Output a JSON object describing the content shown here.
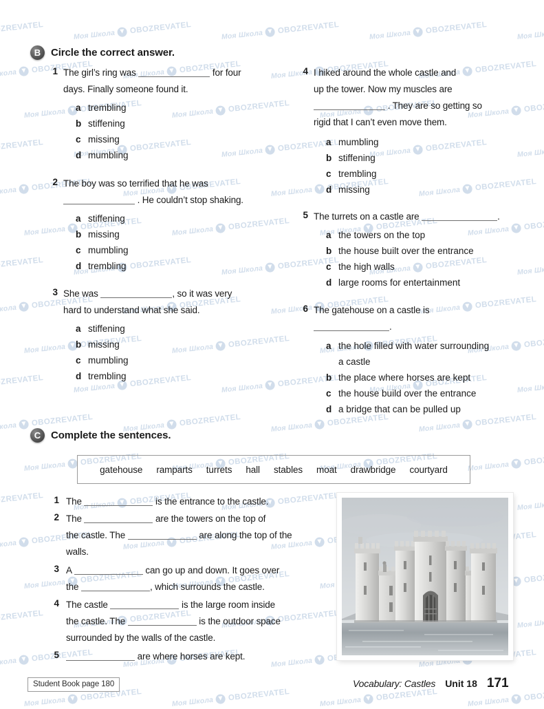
{
  "watermark": {
    "ru": "Моя Школа",
    "en": "OBOZREVATEL"
  },
  "exercise_b": {
    "badge": "B",
    "title": "Circle the correct answer.",
    "questions": [
      {
        "num": "1",
        "lines": [
          "The girl’s ring was ____ for four",
          "days. Finally someone found it."
        ],
        "line1_pre": "The girl’s ring was",
        "line1_post": "for four",
        "line2": "days. Finally someone found it.",
        "options": [
          {
            "letter": "a",
            "text": "trembling"
          },
          {
            "letter": "b",
            "text": "stiffening"
          },
          {
            "letter": "c",
            "text": "missing"
          },
          {
            "letter": "d",
            "text": "mumbling"
          }
        ]
      },
      {
        "num": "2",
        "line1": "The boy was so terrified that he was",
        "line2_post": ". He couldn’t stop shaking.",
        "options": [
          {
            "letter": "a",
            "text": "stiffening"
          },
          {
            "letter": "b",
            "text": "missing"
          },
          {
            "letter": "c",
            "text": "mumbling"
          },
          {
            "letter": "d",
            "text": "trembling"
          }
        ]
      },
      {
        "num": "3",
        "line1_pre": "She was",
        "line1_post": ", so it was very",
        "line2": "hard to understand what she said.",
        "options": [
          {
            "letter": "a",
            "text": "stiffening"
          },
          {
            "letter": "b",
            "text": "missing"
          },
          {
            "letter": "c",
            "text": "mumbling"
          },
          {
            "letter": "d",
            "text": "trembling"
          }
        ]
      },
      {
        "num": "4",
        "line1": "I hiked around the whole castle and",
        "line2": "up the tower. Now my muscles are",
        "line3_post": ". They are so getting so",
        "line4": "rigid that I can’t even move them.",
        "options": [
          {
            "letter": "a",
            "text": "mumbling"
          },
          {
            "letter": "b",
            "text": "stiffening"
          },
          {
            "letter": "c",
            "text": "trembling"
          },
          {
            "letter": "d",
            "text": "missing"
          }
        ]
      },
      {
        "num": "5",
        "line1_pre": "The turrets on a castle are",
        "line1_post": ".",
        "options": [
          {
            "letter": "a",
            "text": "the towers on the top"
          },
          {
            "letter": "b",
            "text": "the house built over the entrance"
          },
          {
            "letter": "c",
            "text": "the high walls"
          },
          {
            "letter": "d",
            "text": "large rooms for entertainment"
          }
        ]
      },
      {
        "num": "6",
        "line1": "The gatehouse on a castle is",
        "line2_post": ".",
        "options": [
          {
            "letter": "a",
            "text": "the hole filled with water surrounding"
          },
          {
            "letter": "a2",
            "text": "a castle"
          },
          {
            "letter": "b",
            "text": "the place where horses are kept"
          },
          {
            "letter": "c",
            "text": "the house build over the entrance"
          },
          {
            "letter": "d",
            "text": "a bridge that can be pulled up"
          }
        ]
      }
    ]
  },
  "exercise_c": {
    "badge": "C",
    "title": "Complete the sentences.",
    "wordbank": [
      "gatehouse",
      "ramparts",
      "turrets",
      "hall",
      "stables",
      "moat",
      "drawbridge",
      "courtyard"
    ],
    "sentences": [
      {
        "num": "1",
        "l1a": "The",
        "l1b": "is the entrance to the castle."
      },
      {
        "num": "2",
        "l1a": "The",
        "l1b": "are the towers on the top of",
        "l2a": "the castle. The",
        "l2b": "are along the top of the",
        "l3": "walls."
      },
      {
        "num": "3",
        "l1a": "A",
        "l1b": "can go up and down. It goes over",
        "l2a": "the",
        "l2b": ", which surrounds the castle."
      },
      {
        "num": "4",
        "l1a": "The castle",
        "l1b": "is the large room inside",
        "l2a": "the castle. The",
        "l2b": "is the outdoor space",
        "l3": "surrounded by the walls of the castle."
      },
      {
        "num": "5",
        "l1a": "",
        "l1b": "are where horses are kept."
      }
    ]
  },
  "picture": {
    "alt": "castle-illustration"
  },
  "footer": {
    "student_book": "Student Book page 180",
    "vocabulary": "Vocabulary: Castles",
    "unit": "Unit 18",
    "page": "171"
  }
}
